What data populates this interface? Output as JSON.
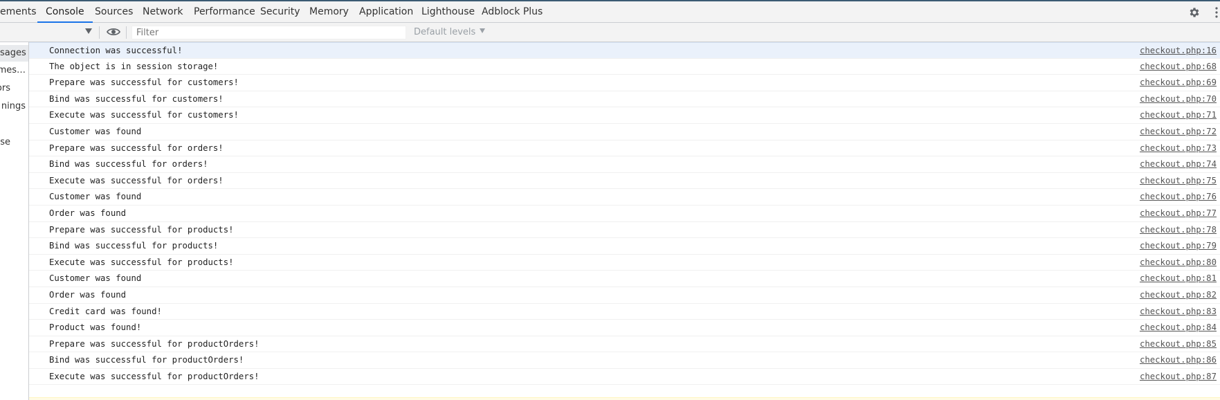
{
  "tabs": [
    "ements",
    "Console",
    "Sources",
    "Network",
    "Performance",
    "Security",
    "Memory",
    "Application",
    "Lighthouse",
    "Adblock Plus"
  ],
  "active_tab": "Console",
  "toolbar": {
    "filter_placeholder": "Filter",
    "levels_label": "Default levels"
  },
  "sidebar": {
    "items": [
      "sages",
      "mes…",
      "ors",
      "nings",
      "ose"
    ]
  },
  "messages": [
    {
      "text": "Connection was successful!",
      "source": "checkout.php:16"
    },
    {
      "text": "The object is in session storage!",
      "source": "checkout.php:68"
    },
    {
      "text": "Prepare was successful for customers!",
      "source": "checkout.php:69"
    },
    {
      "text": "Bind was successful for customers!",
      "source": "checkout.php:70"
    },
    {
      "text": "Execute was successful for customers!",
      "source": "checkout.php:71"
    },
    {
      "text": "Customer was found",
      "source": "checkout.php:72"
    },
    {
      "text": "Prepare was successful for orders!",
      "source": "checkout.php:73"
    },
    {
      "text": "Bind was successful for orders!",
      "source": "checkout.php:74"
    },
    {
      "text": "Execute was successful for orders!",
      "source": "checkout.php:75"
    },
    {
      "text": "Customer was found",
      "source": "checkout.php:76"
    },
    {
      "text": "Order was found",
      "source": "checkout.php:77"
    },
    {
      "text": "Prepare was successful for products!",
      "source": "checkout.php:78"
    },
    {
      "text": "Bind was successful for products!",
      "source": "checkout.php:79"
    },
    {
      "text": "Execute was successful for products!",
      "source": "checkout.php:80"
    },
    {
      "text": "Customer was found",
      "source": "checkout.php:81"
    },
    {
      "text": "Order was found",
      "source": "checkout.php:82"
    },
    {
      "text": "Credit card was found!",
      "source": "checkout.php:83"
    },
    {
      "text": "Product was found!",
      "source": "checkout.php:84"
    },
    {
      "text": "Prepare was successful for productOrders!",
      "source": "checkout.php:85"
    },
    {
      "text": "Bind was successful for productOrders!",
      "source": "checkout.php:86"
    },
    {
      "text": "Execute was successful for productOrders!",
      "source": "checkout.php:87"
    }
  ],
  "colors": {
    "accent": "#1a73e8",
    "selected_row": "#eaf1fb"
  },
  "icons": [
    "settings-gear-icon",
    "more-menu-icon",
    "dropdown-arrow-icon",
    "eye-icon"
  ]
}
